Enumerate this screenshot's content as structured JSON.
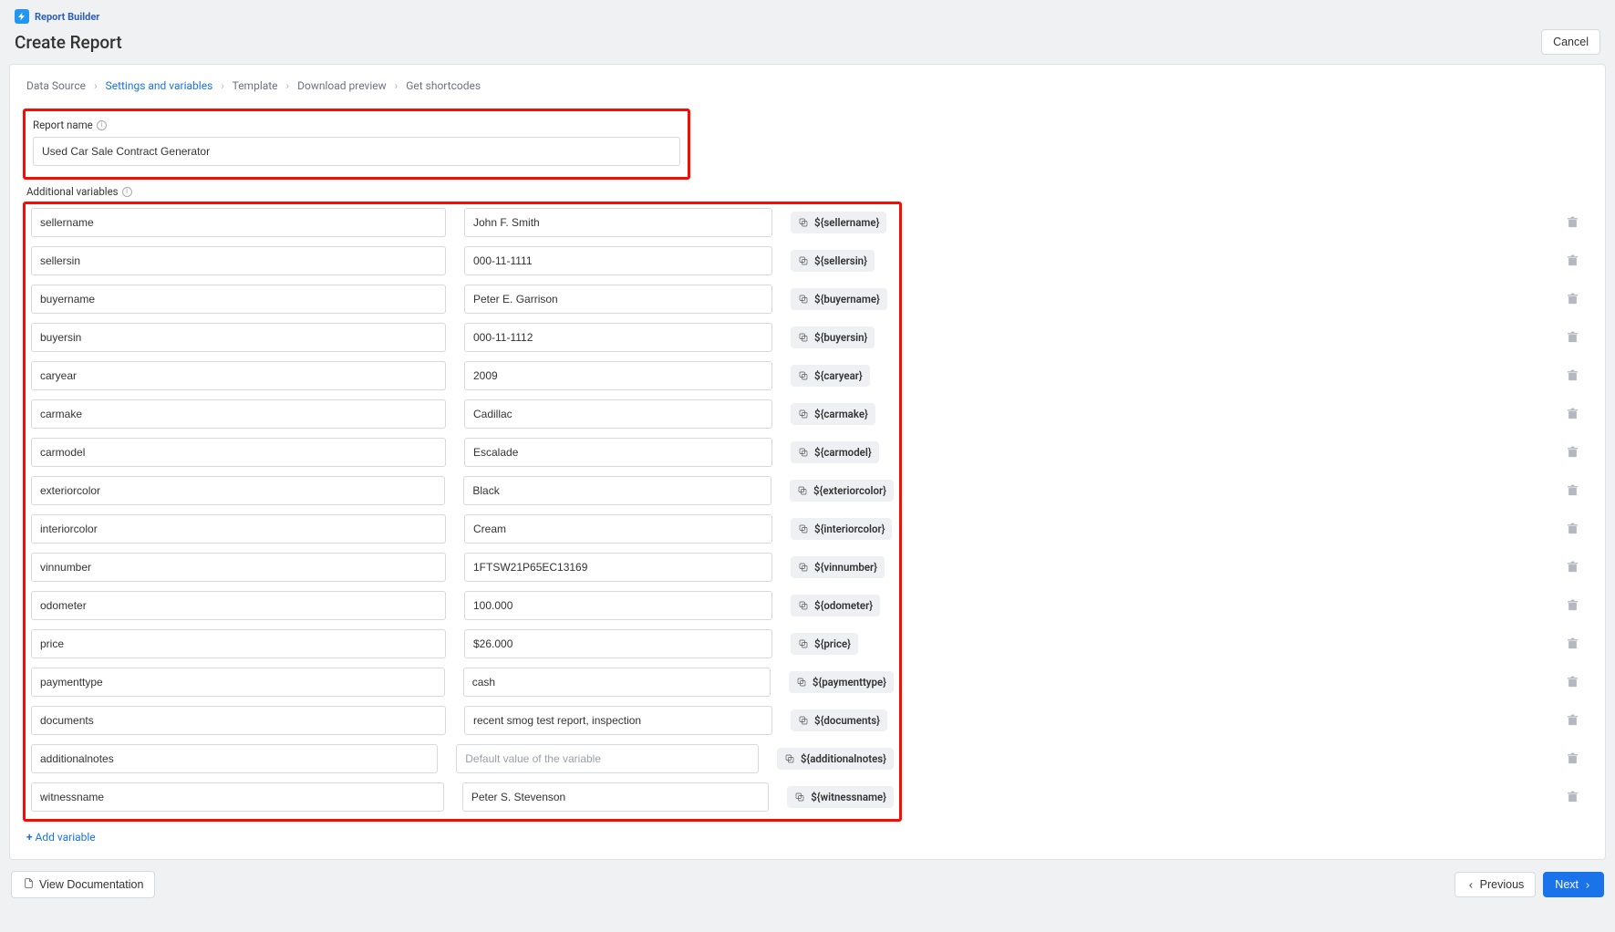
{
  "brand": "Report Builder",
  "page_title": "Create Report",
  "cancel_label": "Cancel",
  "breadcrumb": {
    "data_source": "Data Source",
    "settings": "Settings and variables",
    "template": "Template",
    "download": "Download preview",
    "shortcodes": "Get shortcodes"
  },
  "report_name_label": "Report name",
  "report_name_value": "Used Car Sale Contract Generator",
  "additional_vars_label": "Additional variables",
  "value_placeholder": "Default value of the variable",
  "vars": [
    {
      "name": "sellername",
      "value": "John F. Smith",
      "code": "${sellername}"
    },
    {
      "name": "sellersin",
      "value": "000-11-1111",
      "code": "${sellersin}"
    },
    {
      "name": "buyername",
      "value": "Peter E. Garrison",
      "code": "${buyername}"
    },
    {
      "name": "buyersin",
      "value": "000-11-1112",
      "code": "${buyersin}"
    },
    {
      "name": "caryear",
      "value": "2009",
      "code": "${caryear}"
    },
    {
      "name": "carmake",
      "value": "Cadillac",
      "code": "${carmake}"
    },
    {
      "name": "carmodel",
      "value": "Escalade",
      "code": "${carmodel}"
    },
    {
      "name": "exteriorcolor",
      "value": "Black",
      "code": "${exteriorcolor}"
    },
    {
      "name": "interiorcolor",
      "value": "Cream",
      "code": "${interiorcolor}"
    },
    {
      "name": "vinnumber",
      "value": "1FTSW21P65EC13169",
      "code": "${vinnumber}"
    },
    {
      "name": "odometer",
      "value": "100.000",
      "code": "${odometer}"
    },
    {
      "name": "price",
      "value": "$26.000",
      "code": "${price}"
    },
    {
      "name": "paymenttype",
      "value": "cash",
      "code": "${paymenttype}"
    },
    {
      "name": "documents",
      "value": "recent smog test report, inspection",
      "code": "${documents}"
    },
    {
      "name": "additionalnotes",
      "value": "",
      "code": "${additionalnotes}"
    },
    {
      "name": "witnessname",
      "value": "Peter S. Stevenson",
      "code": "${witnessname}"
    }
  ],
  "add_variable_label": "Add variable",
  "view_doc_label": "View Documentation",
  "previous_label": "Previous",
  "next_label": "Next"
}
